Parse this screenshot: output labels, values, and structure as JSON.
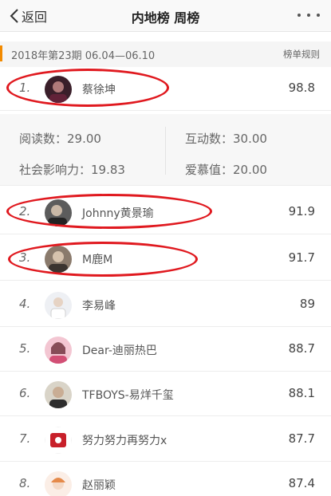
{
  "header": {
    "back_label": "返回",
    "title": "内地榜 周榜"
  },
  "period": {
    "label": "2018年第23期  06.04—06.10",
    "rules_label": "榜单规则"
  },
  "colors": {
    "accent": "#f28a00",
    "annotation": "#e0191f"
  },
  "ranking": [
    {
      "rank": "1.",
      "name": "蔡徐坤",
      "score": "98.8"
    },
    {
      "rank": "2.",
      "name": "Johnny黄景瑜",
      "score": "91.9"
    },
    {
      "rank": "3.",
      "name": "M鹿M",
      "score": "91.7"
    },
    {
      "rank": "4.",
      "name": "李易峰",
      "score": "89"
    },
    {
      "rank": "5.",
      "name": "Dear-迪丽热巴",
      "score": "88.7"
    },
    {
      "rank": "6.",
      "name": "TFBOYS-易烊千玺",
      "score": "88.1"
    },
    {
      "rank": "7.",
      "name": "努力努力再努力x",
      "score": "87.7"
    },
    {
      "rank": "8.",
      "name": "赵丽颖",
      "score": "87.4"
    }
  ],
  "detail": {
    "read": "阅读数：29.00",
    "interact": "互动数：30.00",
    "influence": "社会影响力：19.83",
    "love": "爱慕值：20.00"
  }
}
